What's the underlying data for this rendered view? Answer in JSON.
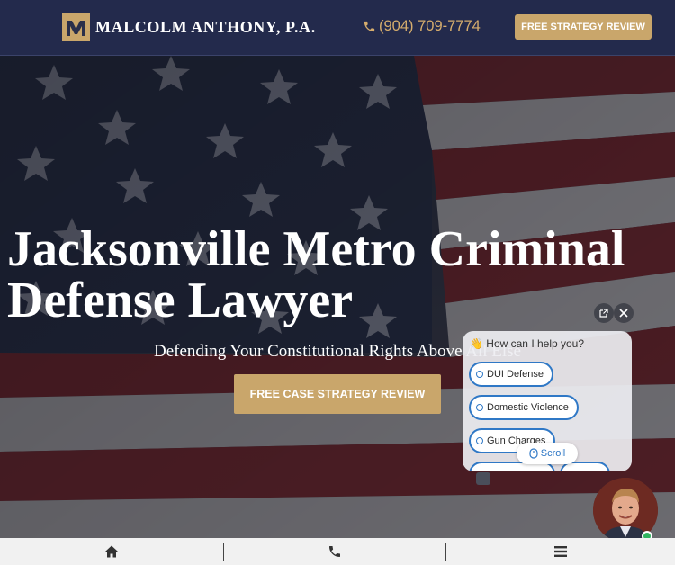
{
  "header": {
    "brand": "MALCOLM ANTHONY, P.A.",
    "phone": "(904) 709-7774",
    "cta_label": "FREE STRATEGY REVIEW"
  },
  "hero": {
    "title_line1": "Jacksonville Metro Criminal",
    "title_line2": "Defense Lawyer",
    "subtitle": "Defending Your Constitutional Rights Above All Else",
    "cta_label": "FREE CASE STRATEGY REVIEW"
  },
  "chat": {
    "greeting": "How can I help you?",
    "greeting_emoji": "👋",
    "options": [
      "DUI Defense",
      "Domestic Violence",
      "Gun Charges"
    ],
    "scroll_label": "Scroll"
  },
  "bottom_nav": {
    "icons": [
      "home-icon",
      "phone-icon",
      "menu-icon"
    ]
  },
  "colors": {
    "navy": "#232a4c",
    "gold": "#c9a66b",
    "phone_gold": "#d6ad6d",
    "chat_blue": "#2f78c6",
    "online_green": "#2fb35f"
  }
}
